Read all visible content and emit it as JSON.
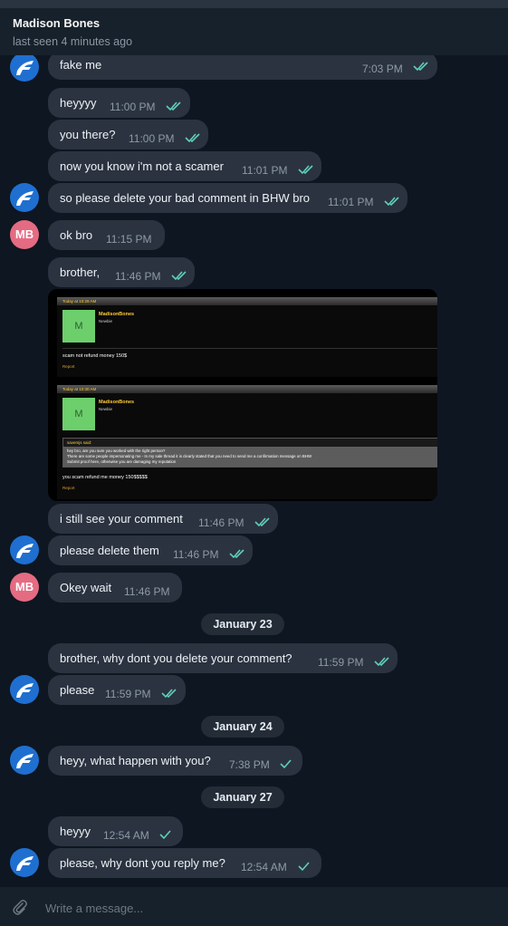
{
  "header": {
    "name": "Madison Bones",
    "status": "last seen 4 minutes ago"
  },
  "messages": [
    {
      "text": "fake me",
      "time": "7:03 PM",
      "read": "double"
    },
    {
      "text": "heyyyy",
      "time": "11:00 PM",
      "read": "double"
    },
    {
      "text": "you there?",
      "time": "11:00 PM",
      "read": "double"
    },
    {
      "text": "now you know i'm not a scamer",
      "time": "11:01 PM",
      "read": "double"
    },
    {
      "text": "so please delete your bad comment in BHW bro",
      "time": "11:01 PM",
      "read": "double"
    },
    {
      "text": "ok bro",
      "time": "11:15 PM",
      "read": "none"
    },
    {
      "text": "brother,",
      "time": "11:46 PM",
      "read": "double"
    },
    {
      "text": "i still see your comment",
      "time": "11:46 PM",
      "read": "double"
    },
    {
      "text": "please delete them",
      "time": "11:46 PM",
      "read": "double"
    },
    {
      "text": "Okey wait",
      "time": "11:46 PM",
      "read": "none"
    },
    {
      "text": "brother, why dont you delete your comment?",
      "time": "11:59 PM",
      "read": "double"
    },
    {
      "text": "please",
      "time": "11:59 PM",
      "read": "double"
    },
    {
      "text": "heyy, what happen with you?",
      "time": "7:38 PM",
      "read": "single"
    },
    {
      "text": "heyyy",
      "time": "12:54 AM",
      "read": "single"
    },
    {
      "text": "please, why dont you reply me?",
      "time": "12:54 AM",
      "read": "single"
    }
  ],
  "dates": [
    "January 23",
    "January 24",
    "January 27"
  ],
  "avatars": {
    "contact_initials": "MB",
    "contact_color": "#e46b82",
    "self_color": "#1f6fd1"
  },
  "screenshot": {
    "post1": {
      "header": "Today at 10:29 AM",
      "box_letter": "M",
      "username": "MadisonBones",
      "role": "Newbie",
      "text": "scam not refund money 150$",
      "report": "Report"
    },
    "post2": {
      "header": "Today at 10:30 AM",
      "box_letter": "M",
      "username": "MadisonBones",
      "role": "Newbie",
      "quote_head": "savemjs said:",
      "quote_line1": "hey bro, are you sure you worked with the right person?",
      "quote_line2": "There are some people impersonating me - In my sale thread it is clearly stated that you need to send me a confirmation message on BHW",
      "quote_line3": "Submit proof here, otherwise you are damaging my reputation",
      "text": "you scam refund me money 150$$$$$",
      "report": "Report"
    }
  },
  "compose": {
    "placeholder": "Write a message..."
  },
  "colors": {
    "background": "#0e1621",
    "bubble": "#2b3340",
    "header": "#17212b",
    "read_tick": "#5fd0b8"
  }
}
